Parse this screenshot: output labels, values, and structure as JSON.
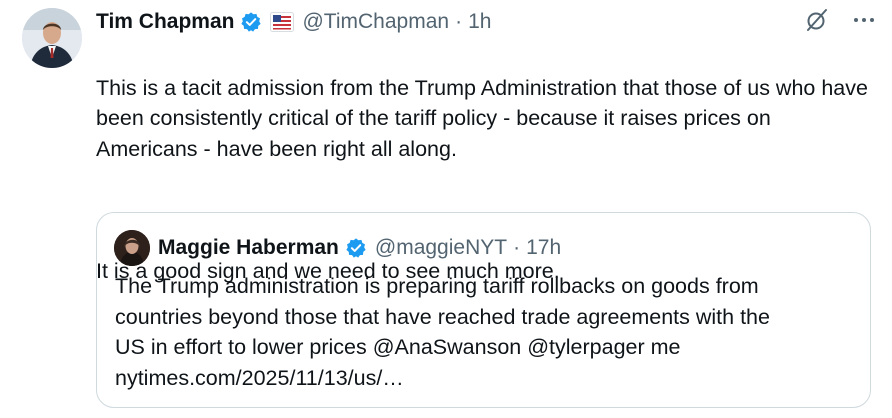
{
  "tweet": {
    "author": {
      "name": "Tim Chapman",
      "handle": "@TimChapman",
      "time": "1h",
      "separator": "·"
    },
    "text_paragraphs": [
      "This is a tacit admission from the Trump Administration that those of us who have been consistently critical of the tariff policy - because it raises prices on Americans - have been right all along.",
      "It is a good sign and we need to see much more."
    ]
  },
  "quote": {
    "author": {
      "name": "Maggie Haberman",
      "handle": "@maggieNYT",
      "time": "17h",
      "separator": "·"
    },
    "text_lines": [
      "The Trump administration is preparing tariff rollbacks on goods from",
      "countries beyond those that have reached trade agreements with the",
      "US in effort to lower prices @AnaSwanson @tylerpager me",
      "nytimes.com/2025/11/13/us/…"
    ]
  },
  "icons": {
    "verified": "verified-badge-icon",
    "flag": "us-flag-icon",
    "grok": "grok-icon",
    "more": "more-icon"
  },
  "colors": {
    "verified_blue": "#1d9bf0",
    "muted_text": "#536471",
    "primary_text": "#0f1419",
    "border": "#cfd9de"
  }
}
